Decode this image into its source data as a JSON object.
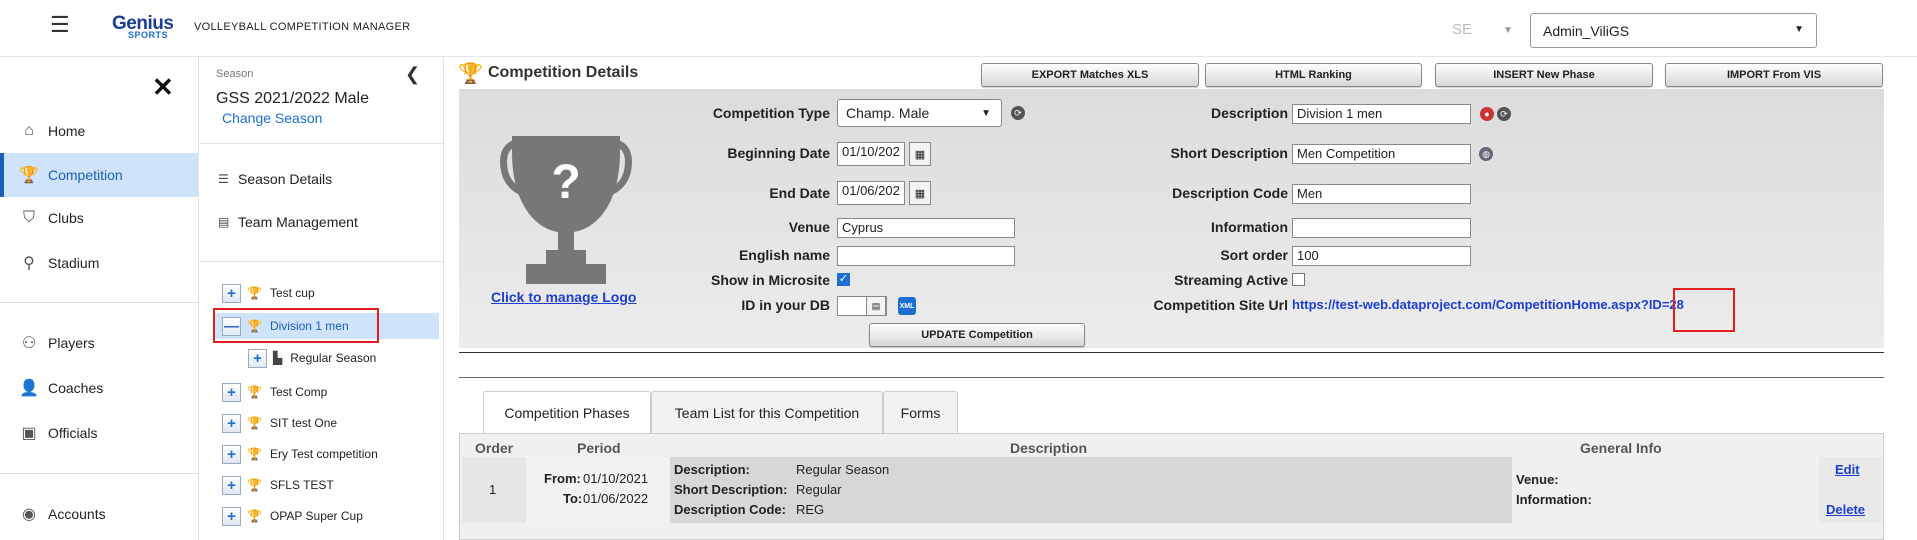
{
  "header": {
    "logo_top": "Genius",
    "logo_bottom": "SPORTS",
    "app_title": "VOLLEYBALL COMPETITION MANAGER",
    "lang": "SE",
    "user": "Admin_ViliGS"
  },
  "nav": {
    "items": [
      {
        "label": "Home",
        "icon": "home-icon"
      },
      {
        "label": "Competition",
        "icon": "trophy-icon"
      },
      {
        "label": "Clubs",
        "icon": "shield-icon"
      },
      {
        "label": "Stadium",
        "icon": "location-pin-icon"
      },
      {
        "label": "Players",
        "icon": "players-icon"
      },
      {
        "label": "Coaches",
        "icon": "coach-icon"
      },
      {
        "label": "Officials",
        "icon": "id-badge-icon"
      },
      {
        "label": "Accounts",
        "icon": "account-icon"
      }
    ]
  },
  "season": {
    "label": "Season",
    "name": "GSS 2021/2022 Male",
    "change": "Change Season",
    "menu": [
      "Season Details",
      "Team Management"
    ],
    "tree": [
      {
        "label": "Test cup"
      },
      {
        "label": "Division 1 men"
      },
      {
        "label": "Regular Season"
      },
      {
        "label": "Test Comp"
      },
      {
        "label": "SIT test One"
      },
      {
        "label": "Ery Test competition"
      },
      {
        "label": "SFLS TEST"
      },
      {
        "label": "OPAP Super Cup"
      }
    ]
  },
  "details": {
    "title": "Competition Details",
    "buttons": [
      "EXPORT Matches XLS",
      "HTML Ranking",
      "INSERT New Phase",
      "IMPORT From VIS"
    ],
    "logo_link": "Click to manage Logo",
    "labels": {
      "competition_type": "Competition Type",
      "beginning_date": "Beginning Date",
      "end_date": "End Date",
      "venue": "Venue",
      "english_name": "English name",
      "show_microsite": "Show in Microsite",
      "id_db": "ID in your DB",
      "description": "Description",
      "short_description": "Short Description",
      "description_code": "Description Code",
      "information": "Information",
      "sort_order": "Sort order",
      "streaming": "Streaming Active",
      "site_url": "Competition Site Url"
    },
    "values": {
      "competition_type": "Champ. Male",
      "beginning_date": "01/10/202",
      "end_date": "01/06/202",
      "venue": "Cyprus",
      "english_name": "",
      "show_microsite": true,
      "id_db": "",
      "description": "Division 1 men",
      "short_description": "Men Competition",
      "description_code": "Men",
      "information": "",
      "sort_order": "100",
      "streaming": false,
      "site_url": "https://test-web.dataproject.com/CompetitionHome.aspx?ID=28"
    },
    "xml_badge": "XML",
    "update_button": "UPDATE Competition"
  },
  "tabs": [
    "Competition Phases",
    "Team List for this Competition",
    "Forms"
  ],
  "phases": {
    "headers": [
      "Order",
      "Period",
      "Description",
      "General Info"
    ],
    "rows": [
      {
        "order": "1",
        "from_label": "From:",
        "from": "01/10/2021",
        "to_label": "To:",
        "to": "01/06/2022",
        "desc_label": "Description:",
        "desc": "Regular Season",
        "short_label": "Short Description:",
        "short": "Regular",
        "code_label": "Description Code:",
        "code": "REG",
        "venue_label": "Venue:",
        "info_label": "Information:",
        "edit": "Edit",
        "delete": "Delete"
      }
    ]
  }
}
